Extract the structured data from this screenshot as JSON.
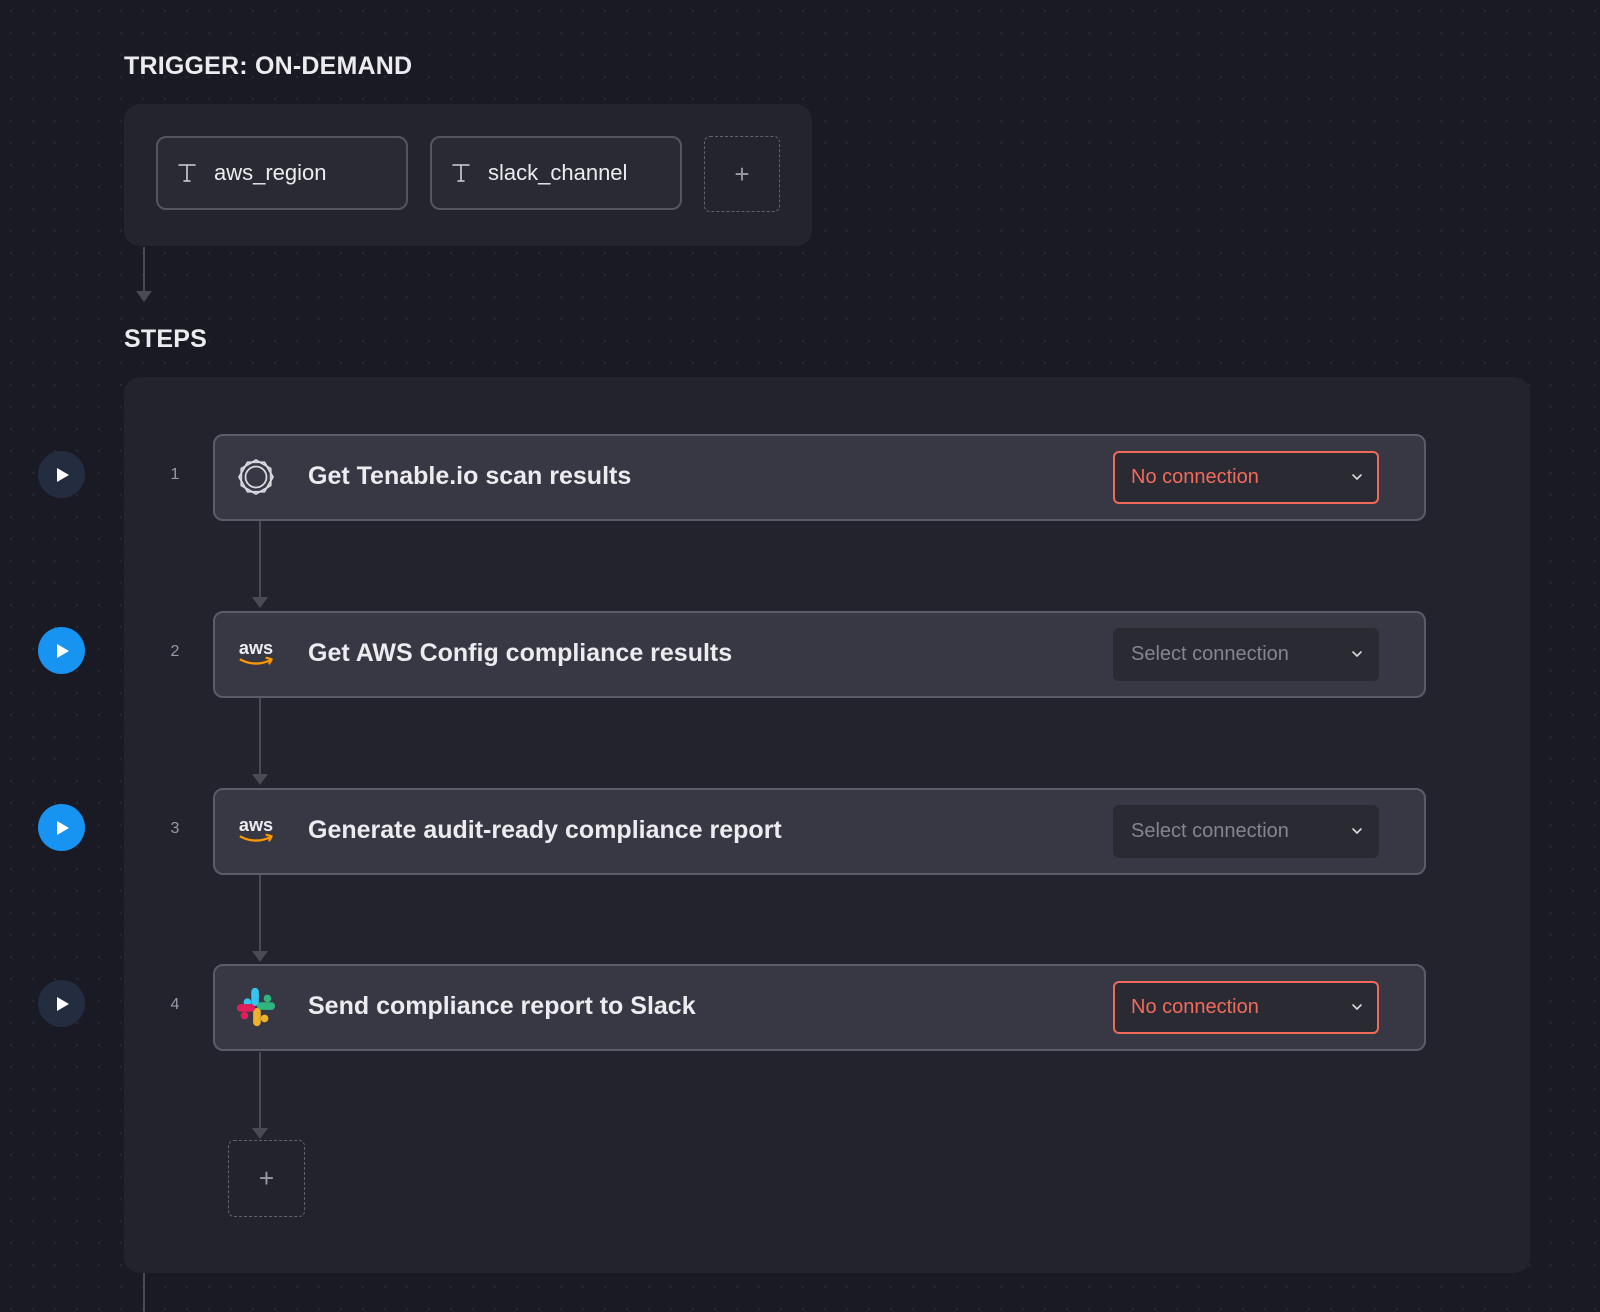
{
  "trigger": {
    "title": "TRIGGER: ON-DEMAND",
    "parameters": [
      {
        "label": "aws_region",
        "icon": "text-type-icon"
      },
      {
        "label": "slack_channel",
        "icon": "text-type-icon"
      }
    ],
    "add_label": "+"
  },
  "steps_section": {
    "title": "STEPS",
    "add_label": "+",
    "steps": [
      {
        "number": "1",
        "title": "Get Tenable.io scan results",
        "icon": "tenable-icon",
        "connection": "No connection",
        "connection_state": "error",
        "run_button": "dark"
      },
      {
        "number": "2",
        "title": "Get AWS Config compliance results",
        "icon": "aws-icon",
        "connection": "Select connection",
        "connection_state": "neutral",
        "run_button": "blue"
      },
      {
        "number": "3",
        "title": "Generate audit-ready compliance report",
        "icon": "aws-icon",
        "connection": "Select connection",
        "connection_state": "neutral",
        "run_button": "blue"
      },
      {
        "number": "4",
        "title": "Send compliance report to Slack",
        "icon": "slack-icon",
        "connection": "No connection",
        "connection_state": "error",
        "run_button": "dark"
      }
    ]
  },
  "colors": {
    "background": "#1a1a24",
    "panel": "#24242e",
    "card": "#383844",
    "error": "#f06a5a",
    "accent_blue": "#1793f2",
    "aws_orange": "#ff9900"
  }
}
